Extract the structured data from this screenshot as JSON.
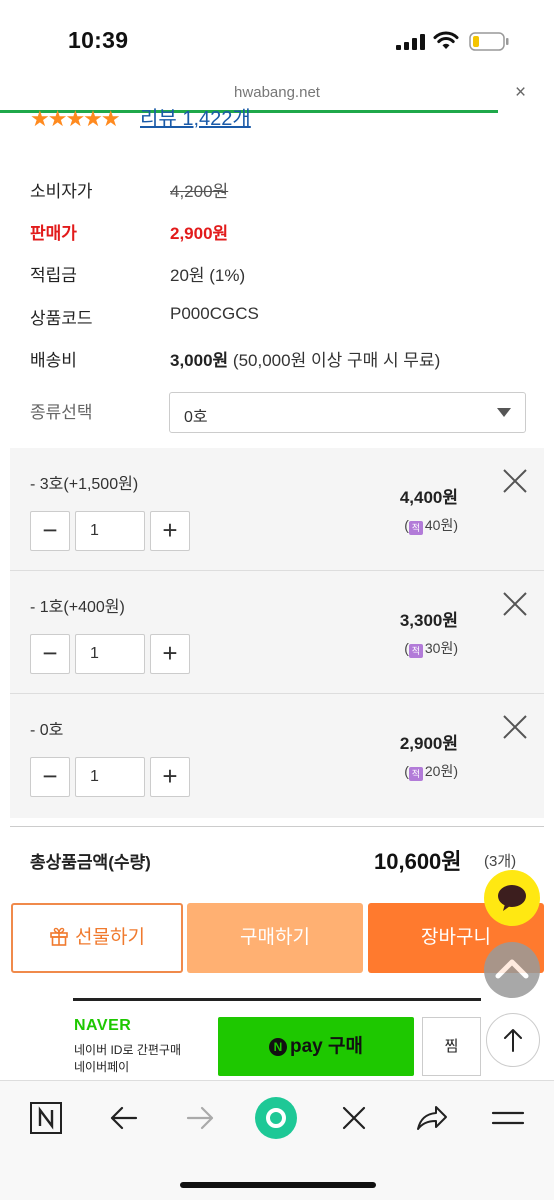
{
  "status": {
    "time": "10:39"
  },
  "browser": {
    "url": "hwabang.net",
    "close": "×"
  },
  "product": {
    "stars": "★★★★★",
    "review_link": "리뷰 1,422개",
    "rows": [
      {
        "label": "소비자가",
        "value": "4,200원"
      },
      {
        "label": "판매가",
        "value": "2,900원"
      },
      {
        "label": "적립금",
        "value": "20원 (1%)"
      },
      {
        "label": "상품코드",
        "value": "P000CGCS"
      },
      {
        "label": "배송비",
        "value_bold": "3,000원",
        "value": "(50,000원 이상 구매 시 무료)"
      }
    ],
    "select_label": "종류선택",
    "select_value": "0호"
  },
  "options": [
    {
      "name": "- 3호(+1,500원)",
      "qty": "1",
      "price": "4,400원",
      "points": "40원",
      "minus": "−",
      "plus": "+"
    },
    {
      "name": "- 1호(+400원)",
      "qty": "1",
      "price": "3,300원",
      "points": "30원",
      "minus": "−",
      "plus": "+"
    },
    {
      "name": "- 0호",
      "qty": "1",
      "price": "2,900원",
      "points": "20원",
      "minus": "−",
      "plus": "+"
    }
  ],
  "points_icon": "적",
  "total": {
    "label": "총상품금액(수량)",
    "value": "10,600원",
    "count": "(3개)"
  },
  "actions": {
    "gift": "선물하기",
    "buy": "구매하기",
    "cart": "장바구니"
  },
  "naverpay": {
    "logo": "NAVER",
    "line1": "네이버 ID로 간편구매",
    "line2": "네이버페이",
    "pay_icon": "N",
    "pay_label": "pay 구매",
    "zzim": "찜"
  },
  "colors": {
    "accent": "#ff7a2e",
    "price_red": "#e21b1b",
    "naver_green": "#1ec800",
    "progress": "#1fa84a"
  }
}
